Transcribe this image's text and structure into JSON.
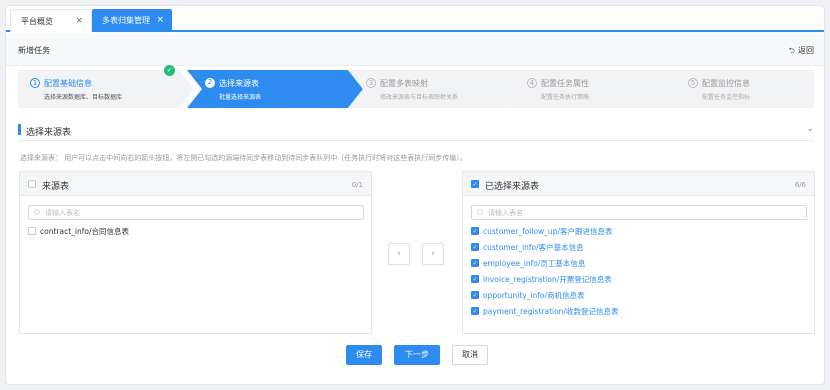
{
  "tabs": [
    {
      "label": "平台概览",
      "close": "×"
    },
    {
      "label": "多表归集管理",
      "close": "×"
    }
  ],
  "header": {
    "title": "新增任务",
    "back_label": "返回"
  },
  "steps": [
    {
      "num": "1",
      "title": "配置基础信息",
      "desc": "选择来源数据库、目标数据库",
      "state": "done"
    },
    {
      "num": "2",
      "title": "选择来源表",
      "desc": "批量选择来源表",
      "state": "active"
    },
    {
      "num": "3",
      "title": "配置多表映射",
      "desc": "修改来源表与目标表映射关系",
      "state": "todo"
    },
    {
      "num": "4",
      "title": "配置任务属性",
      "desc": "配置任务执行策略",
      "state": "todo"
    },
    {
      "num": "5",
      "title": "配置监控信息",
      "desc": "配置任务监控指标",
      "state": "todo"
    }
  ],
  "section": {
    "title": "选择来源表"
  },
  "hint": "选择来源表：  用户可以点击中间向右的箭头按钮，将左侧已勾选的源端待同步表移动到待同步表队列中（任务执行时将对这些表执行同步传输）。",
  "left_panel": {
    "title": "来源表",
    "count": "0/1",
    "search_placeholder": "请输入表名",
    "items": [
      {
        "label": "contract_info/合同信息表",
        "checked": false
      }
    ]
  },
  "right_panel": {
    "title": "已选择来源表",
    "count": "6/6",
    "search_placeholder": "请输入表名",
    "items": [
      {
        "label": "customer_follow_up/客户跟进信息表",
        "checked": true
      },
      {
        "label": "customer_info/客户基本信息",
        "checked": true
      },
      {
        "label": "employee_info/员工基本信息",
        "checked": true
      },
      {
        "label": "invoice_registration/开票登记信息表",
        "checked": true
      },
      {
        "label": "opportunity_info/商机信息表",
        "checked": true
      },
      {
        "label": "payment_registration/收款登记信息表",
        "checked": true
      }
    ]
  },
  "transfer": {
    "left_arrow": "‹",
    "right_arrow": "›"
  },
  "buttons": {
    "save": "保存",
    "next": "下一步",
    "cancel": "取消"
  },
  "colors": {
    "accent": "#2e8cf0",
    "success": "#1fbf7a",
    "step_inactive": "#f2f3f5"
  }
}
